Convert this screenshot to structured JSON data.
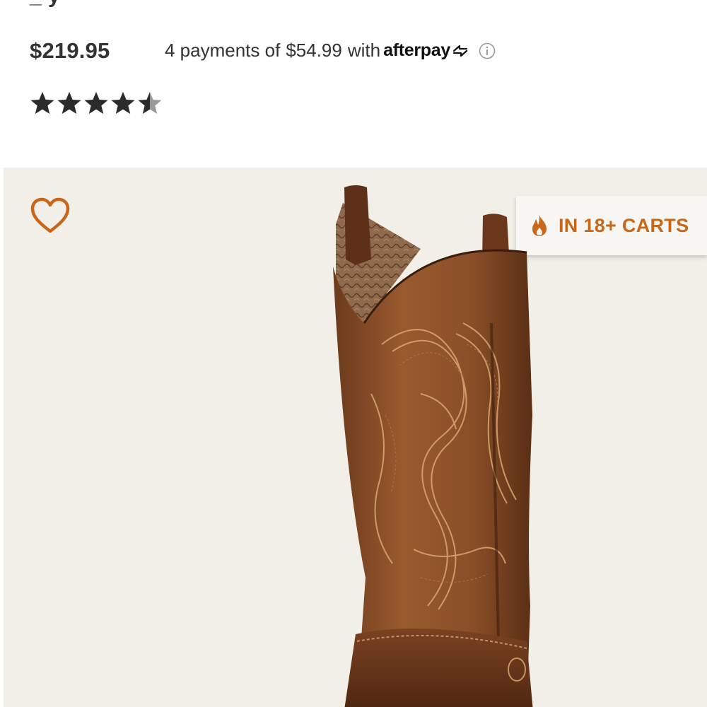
{
  "header": {
    "title_remnant": "_ y"
  },
  "pricing": {
    "price": "$219.95",
    "installment_prefix": "4 payments of",
    "installment_amount": "$54.99",
    "installment_suffix": "with",
    "provider_name": "afterpay"
  },
  "rating": {
    "stars_filled": 4.5,
    "stars_total": 5,
    "star_color": "#2b2b2b",
    "star_empty_color": "#9a9a9a"
  },
  "product_image": {
    "background": "#f2efe9",
    "wishlist_icon": "heart-outline-icon",
    "badge": {
      "icon": "flame-icon",
      "label": "IN 18+ CARTS",
      "color": "#c8661a"
    }
  },
  "colors": {
    "accent": "#c8661a",
    "text": "#333333"
  }
}
